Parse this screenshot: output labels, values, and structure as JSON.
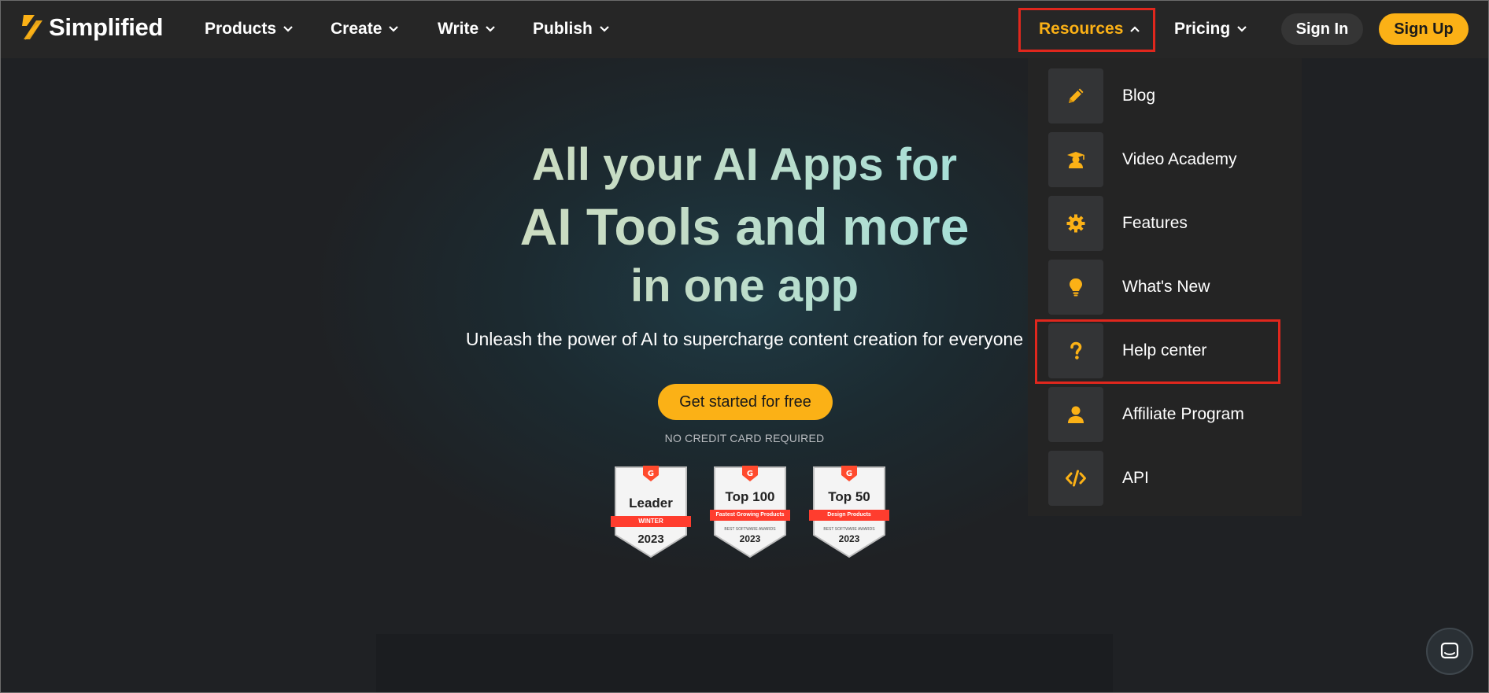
{
  "brand": {
    "name": "Simplified",
    "accent": "#fbb116",
    "highlight": "#e0271d"
  },
  "nav": {
    "items": [
      {
        "label": "Products",
        "icon": "chevron-down-icon"
      },
      {
        "label": "Create",
        "icon": "chevron-down-icon"
      },
      {
        "label": "Write",
        "icon": "chevron-down-icon"
      },
      {
        "label": "Publish",
        "icon": "chevron-down-icon"
      },
      {
        "label": "Resources",
        "icon": "chevron-up-icon",
        "active": true
      },
      {
        "label": "Pricing",
        "icon": "chevron-down-icon"
      }
    ],
    "sign_in": "Sign In",
    "sign_up": "Sign Up"
  },
  "hero": {
    "line1": "All your AI Apps for",
    "line2": "AI Tools and more",
    "line3": "in one app",
    "tagline": "Unleash the power of AI to supercharge content creation for everyone",
    "cta": "Get started for free",
    "note": "NO CREDIT CARD REQUIRED"
  },
  "badges": [
    {
      "title": "Leader",
      "ribbon": "WINTER",
      "sub": "",
      "year": "2023"
    },
    {
      "title": "Top 100",
      "ribbon": "Fastest Growing Products",
      "sub": "BEST SOFTWARE AWARDS",
      "year": "2023"
    },
    {
      "title": "Top 50",
      "ribbon": "Design Products",
      "sub": "BEST SOFTWARE AWARDS",
      "year": "2023"
    }
  ],
  "resources_menu": [
    {
      "label": "Blog",
      "icon": "pencil-icon"
    },
    {
      "label": "Video Academy",
      "icon": "graduate-icon"
    },
    {
      "label": "Features",
      "icon": "gear-icon"
    },
    {
      "label": "What's New",
      "icon": "lightbulb-icon"
    },
    {
      "label": "Help center",
      "icon": "question-icon"
    },
    {
      "label": "Affiliate Program",
      "icon": "user-icon"
    },
    {
      "label": "API",
      "icon": "code-icon"
    }
  ],
  "chat": {
    "icon": "chat-icon"
  }
}
